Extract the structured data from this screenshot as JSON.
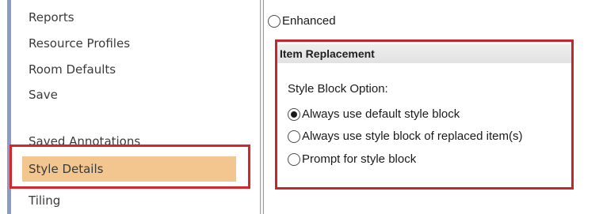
{
  "nav": {
    "items": [
      {
        "label": "Reports"
      },
      {
        "label": "Resource Profiles"
      },
      {
        "label": "Room Defaults"
      },
      {
        "label": "Save"
      },
      {
        "label": "Saved Annotations"
      },
      {
        "label": "Style Details",
        "selected": true
      },
      {
        "label": "Tiling"
      }
    ]
  },
  "options": {
    "enhanced_label": "Enhanced",
    "item_replacement": {
      "header": "Item Replacement",
      "field_label": "Style Block Option:",
      "options": [
        {
          "label": "Always use default style block",
          "checked": true
        },
        {
          "label": "Always use style block of replaced item(s)",
          "checked": false
        },
        {
          "label": "Prompt for style block",
          "checked": false
        }
      ]
    }
  },
  "colors": {
    "selection": "#f3c58f",
    "highlight": "#d4262d",
    "accent": "#8b9bc1"
  }
}
